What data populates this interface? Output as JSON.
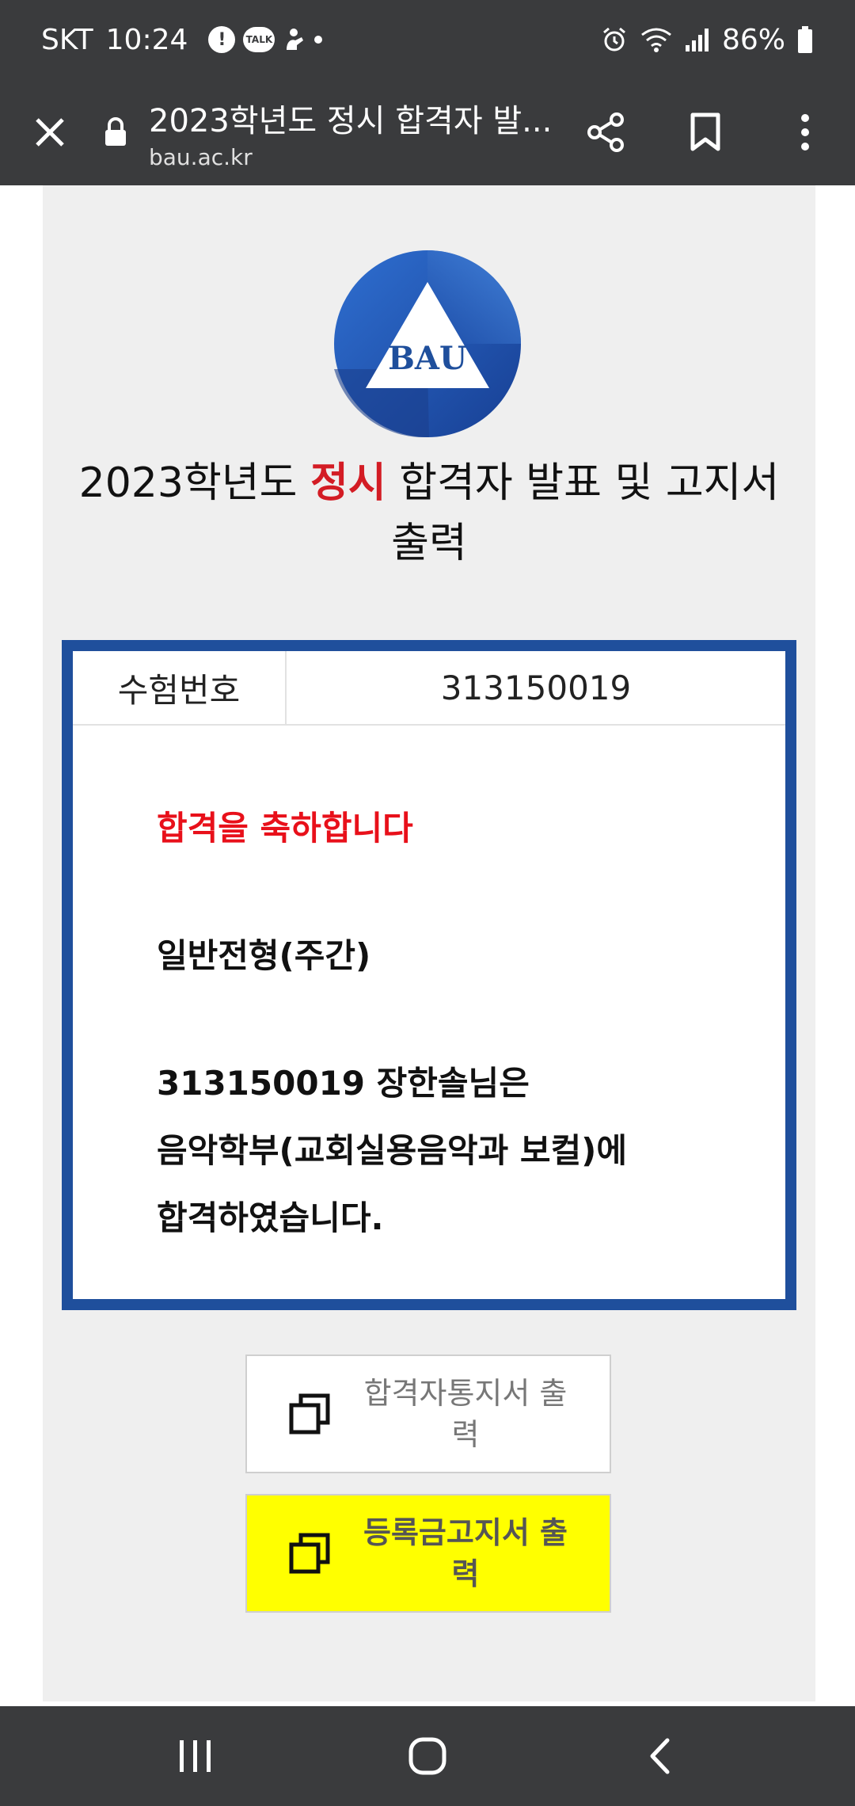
{
  "status_bar": {
    "carrier": "SKT",
    "time": "10:24",
    "battery": "86%"
  },
  "browser": {
    "page_title": "2023학년도 정시 합격자 발...",
    "domain": "bau.ac.kr"
  },
  "logo": {
    "text": "BAU"
  },
  "headline": {
    "part1": "2023학년도 ",
    "accent": "정시",
    "part2": " 합격자 발표 및 고지서 출력"
  },
  "result": {
    "id_label": "수험번호",
    "id_value": "313150019",
    "congrats": "합격을 축하합니다",
    "admission_type": "일반전형(주간)",
    "line_name": "313150019 장한솔님은",
    "line_dept": "음악학부(교회실용음악과 보컬)에",
    "line_passed": "합격하였습니다."
  },
  "buttons": {
    "notice_label": "합격자통지서 출력",
    "tuition_label": "등록금고지서 출력"
  },
  "colors": {
    "accent_red": "#d31c24",
    "box_border": "#1f4f9c",
    "tuition_button": "#ffff00"
  }
}
